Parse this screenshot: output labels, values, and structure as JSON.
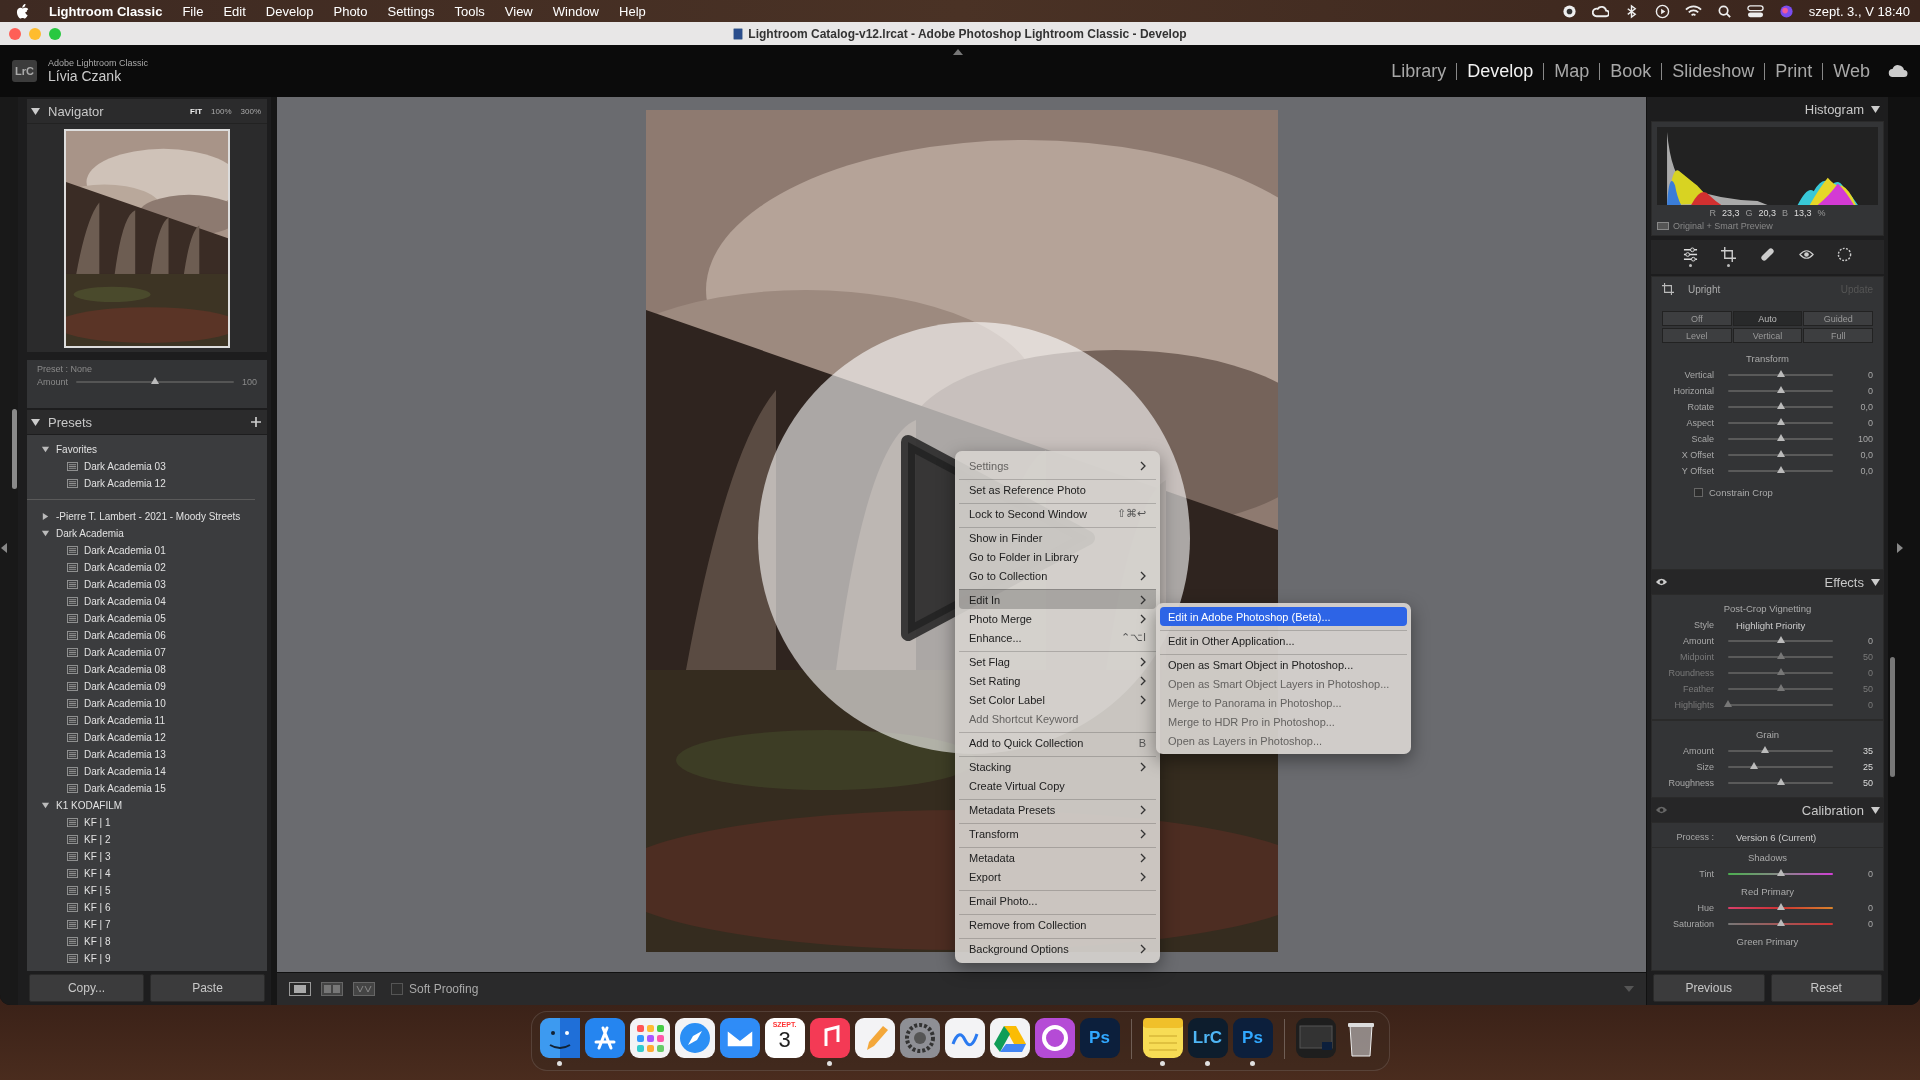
{
  "menu_bar": {
    "app": "Lightroom Classic",
    "items": [
      "File",
      "Edit",
      "Develop",
      "Photo",
      "Settings",
      "Tools",
      "View",
      "Window",
      "Help"
    ],
    "clock": "szept. 3., V 18:40"
  },
  "window": {
    "title": "Lightroom Catalog-v12.lrcat - Adobe Photoshop Lightroom Classic - Develop"
  },
  "identity": {
    "logo": "LrC",
    "product": "Adobe Lightroom Classic",
    "user": "Lívia Czank"
  },
  "modules": [
    {
      "label": "Library",
      "selected": false
    },
    {
      "label": "Develop",
      "selected": true
    },
    {
      "label": "Map",
      "selected": false
    },
    {
      "label": "Book",
      "selected": false
    },
    {
      "label": "Slideshow",
      "selected": false
    },
    {
      "label": "Print",
      "selected": false
    },
    {
      "label": "Web",
      "selected": false
    }
  ],
  "navigator": {
    "title": "Navigator",
    "zoom_options": [
      "FIT",
      "100%",
      "300%"
    ]
  },
  "preset_amount": {
    "preset": "Preset : None",
    "label": "Amount",
    "value": "100",
    "level": 0.5
  },
  "presets": {
    "title": "Presets",
    "tree": [
      {
        "label": "Favorites",
        "expanded": true,
        "separator_after": true,
        "children": [
          {
            "label": "Dark Academia 03"
          },
          {
            "label": "Dark Academia 12"
          }
        ]
      },
      {
        "label": "-Pierre T. Lambert - 2021 - Moody Streets",
        "expanded": false,
        "separator_after": false
      },
      {
        "label": "Dark Academia",
        "expanded": true,
        "separator_after": false,
        "children": [
          {
            "label": "Dark Academia 01"
          },
          {
            "label": "Dark Academia 02"
          },
          {
            "label": "Dark Academia 03"
          },
          {
            "label": "Dark Academia 04"
          },
          {
            "label": "Dark Academia 05"
          },
          {
            "label": "Dark Academia 06"
          },
          {
            "label": "Dark Academia 07"
          },
          {
            "label": "Dark Academia 08"
          },
          {
            "label": "Dark Academia 09"
          },
          {
            "label": "Dark Academia 10"
          },
          {
            "label": "Dark Academia 11"
          },
          {
            "label": "Dark Academia 12"
          },
          {
            "label": "Dark Academia 13"
          },
          {
            "label": "Dark Academia 14"
          },
          {
            "label": "Dark Academia 15"
          }
        ]
      },
      {
        "label": "K1 KODAFILM",
        "expanded": true,
        "separator_after": false,
        "children": [
          {
            "label": "KF | 1"
          },
          {
            "label": "KF | 2"
          },
          {
            "label": "KF | 3"
          },
          {
            "label": "KF | 4"
          },
          {
            "label": "KF | 5"
          },
          {
            "label": "KF | 6"
          },
          {
            "label": "KF | 7"
          },
          {
            "label": "KF | 8"
          },
          {
            "label": "KF | 9"
          }
        ]
      }
    ]
  },
  "left_buttons": [
    "Copy...",
    "Paste"
  ],
  "toolbar": {
    "soft_proofing": {
      "label": "Soft Proofing",
      "checked": false
    }
  },
  "context_menu": [
    {
      "label": "Settings",
      "submenu": true,
      "separator_before": false,
      "disabled": true,
      "selected": false
    },
    {
      "label": "Set as Reference Photo",
      "submenu": false,
      "separator_before": true,
      "disabled": false,
      "selected": false
    },
    {
      "label": "Lock to Second Window",
      "shortcut": "⇧⌘↩",
      "submenu": false,
      "separator_before": true,
      "disabled": false,
      "selected": false
    },
    {
      "label": "Show in Finder",
      "submenu": false,
      "separator_before": true,
      "disabled": false,
      "selected": false
    },
    {
      "label": "Go to Folder in Library",
      "submenu": false,
      "separator_before": false,
      "disabled": false,
      "selected": false
    },
    {
      "label": "Go to Collection",
      "submenu": true,
      "separator_before": false,
      "disabled": false,
      "selected": false
    },
    {
      "label": "Edit In",
      "submenu": true,
      "separator_before": true,
      "disabled": false,
      "selected": true
    },
    {
      "label": "Photo Merge",
      "submenu": true,
      "separator_before": false,
      "disabled": false,
      "selected": false
    },
    {
      "label": "Enhance...",
      "shortcut": "⌃⌥I",
      "submenu": false,
      "separator_before": false,
      "disabled": false,
      "selected": false
    },
    {
      "label": "Set Flag",
      "submenu": true,
      "separator_before": true,
      "disabled": false,
      "selected": false
    },
    {
      "label": "Set Rating",
      "submenu": true,
      "separator_before": false,
      "disabled": false,
      "selected": false
    },
    {
      "label": "Set Color Label",
      "submenu": true,
      "separator_before": false,
      "disabled": false,
      "selected": false
    },
    {
      "label": "Add Shortcut Keyword",
      "submenu": false,
      "separator_before": false,
      "disabled": true,
      "selected": false
    },
    {
      "label": "Add to Quick Collection",
      "shortcut": "B",
      "submenu": false,
      "separator_before": true,
      "disabled": false,
      "selected": false
    },
    {
      "label": "Stacking",
      "submenu": true,
      "separator_before": true,
      "disabled": false,
      "selected": false
    },
    {
      "label": "Create Virtual Copy",
      "submenu": false,
      "separator_before": false,
      "disabled": false,
      "selected": false
    },
    {
      "label": "Metadata Presets",
      "submenu": true,
      "separator_before": true,
      "disabled": false,
      "selected": false
    },
    {
      "label": "Transform",
      "submenu": true,
      "separator_before": true,
      "disabled": false,
      "selected": false
    },
    {
      "label": "Metadata",
      "submenu": true,
      "separator_before": true,
      "disabled": false,
      "selected": false
    },
    {
      "label": "Export",
      "submenu": true,
      "separator_before": false,
      "disabled": false,
      "selected": false
    },
    {
      "label": "Email Photo...",
      "submenu": false,
      "separator_before": true,
      "disabled": false,
      "selected": false
    },
    {
      "label": "Remove from Collection",
      "submenu": false,
      "separator_before": true,
      "disabled": false,
      "selected": false
    },
    {
      "label": "Background Options",
      "submenu": true,
      "separator_before": true,
      "disabled": false,
      "selected": false
    }
  ],
  "submenu": [
    {
      "label": "Edit in Adobe Photoshop (Beta)...",
      "separator_before": false,
      "disabled": false,
      "selected": true
    },
    {
      "label": "Edit in Other Application...",
      "separator_before": true,
      "disabled": false,
      "selected": false
    },
    {
      "label": "Open as Smart Object in Photoshop...",
      "separator_before": true,
      "disabled": false,
      "selected": false
    },
    {
      "label": "Open as Smart Object Layers in Photoshop...",
      "separator_before": false,
      "disabled": true,
      "selected": false
    },
    {
      "label": "Merge to Panorama in Photoshop...",
      "separator_before": false,
      "disabled": true,
      "selected": false
    },
    {
      "label": "Merge to HDR Pro in Photoshop...",
      "separator_before": false,
      "disabled": true,
      "selected": false
    },
    {
      "label": "Open as Layers in Photoshop...",
      "separator_before": false,
      "disabled": true,
      "selected": false
    }
  ],
  "histogram": {
    "title": "Histogram",
    "readout": [
      {
        "channel": "R",
        "value": "23,3"
      },
      {
        "channel": "G",
        "value": "20,3"
      },
      {
        "channel": "B",
        "value": "13,3"
      }
    ],
    "unit": "%",
    "preview": "Original + Smart Preview"
  },
  "tool_strip": [
    {
      "kind": "sliders",
      "dot": true
    },
    {
      "kind": "crop",
      "dot": true
    },
    {
      "kind": "heal",
      "dot": false
    },
    {
      "kind": "redeye",
      "dot": false
    },
    {
      "kind": "mask",
      "dot": false
    }
  ],
  "upright": {
    "title": "Upright",
    "action": "Update",
    "modes": [
      {
        "label": "Off",
        "selected": false
      },
      {
        "label": "Auto",
        "selected": true
      },
      {
        "label": "Guided",
        "selected": false
      },
      {
        "label": "Level",
        "selected": false
      },
      {
        "label": "Vertical",
        "selected": false
      },
      {
        "label": "Full",
        "selected": false
      }
    ]
  },
  "transform": {
    "title": "Transform",
    "sliders": [
      {
        "name": "Vertical",
        "value": "0",
        "level": 0.5
      },
      {
        "name": "Horizontal",
        "value": "0",
        "level": 0.5
      },
      {
        "name": "Rotate",
        "value": "0,0",
        "level": 0.5
      },
      {
        "name": "Aspect",
        "value": "0",
        "level": 0.5
      },
      {
        "name": "Scale",
        "value": "100",
        "level": 0.5
      },
      {
        "name": "X Offset",
        "value": "0,0",
        "level": 0.5
      },
      {
        "name": "Y Offset",
        "value": "0,0",
        "level": 0.5
      }
    ],
    "constrain_crop": {
      "label": "Constrain Crop",
      "checked": false
    }
  },
  "effects": {
    "title": "Effects",
    "vignetting": {
      "title": "Post-Crop Vignetting",
      "style_label": "Style",
      "style": "Highlight Priority",
      "sliders": [
        {
          "name": "Amount",
          "value": "0",
          "level": 0.5,
          "disabled": false
        },
        {
          "name": "Midpoint",
          "value": "50",
          "level": 0.5,
          "disabled": true
        },
        {
          "name": "Roundness",
          "value": "0",
          "level": 0.5,
          "disabled": true
        },
        {
          "name": "Feather",
          "value": "50",
          "level": 0.5,
          "disabled": true
        },
        {
          "name": "Highlights",
          "value": "0",
          "level": 0,
          "disabled": true
        }
      ]
    },
    "grain": {
      "title": "Grain",
      "sliders": [
        {
          "name": "Amount",
          "value": "35",
          "level": 0.35,
          "disabled": false
        },
        {
          "name": "Size",
          "value": "25",
          "level": 0.25,
          "disabled": false
        },
        {
          "name": "Roughness",
          "value": "50",
          "level": 0.5,
          "disabled": false
        }
      ]
    }
  },
  "calibration": {
    "title": "Calibration",
    "process_label": "Process :",
    "process": "Version 6 (Current)",
    "groups": [
      {
        "title": "Shadows",
        "sliders": [
          {
            "name": "Tint",
            "value": "0",
            "level": 0.5,
            "kind": "tint"
          }
        ]
      },
      {
        "title": "Red Primary",
        "sliders": [
          {
            "name": "Hue",
            "value": "0",
            "level": 0.5,
            "kind": "hue"
          },
          {
            "name": "Saturation",
            "value": "0",
            "level": 0.5,
            "kind": "saturation"
          }
        ]
      },
      {
        "title": "Green Primary"
      }
    ]
  },
  "right_buttons": [
    "Previous",
    "Reset"
  ],
  "dock": [
    {
      "kind": "finder",
      "running": true
    },
    {
      "kind": "appstore",
      "running": false
    },
    {
      "kind": "launchpad",
      "running": false
    },
    {
      "kind": "safari",
      "running": false
    },
    {
      "kind": "mail",
      "running": false
    },
    {
      "kind": "calendar",
      "month": "SZEPT.",
      "day": "3",
      "running": false
    },
    {
      "kind": "music",
      "running": true
    },
    {
      "kind": "pencil",
      "running": false
    },
    {
      "kind": "settings",
      "running": false
    },
    {
      "kind": "freeform",
      "running": false
    },
    {
      "kind": "drive",
      "running": false
    },
    {
      "kind": "cloud",
      "running": false
    },
    {
      "kind": "ps",
      "text": "Ps",
      "running": false
    },
    {
      "kind": "divider"
    },
    {
      "kind": "notes",
      "running": true
    },
    {
      "kind": "lrc",
      "text": "LrC",
      "running": true
    },
    {
      "kind": "ps",
      "text": "Ps",
      "running": true
    },
    {
      "kind": "divider"
    },
    {
      "kind": "window",
      "running": false
    },
    {
      "kind": "trash",
      "running": false
    }
  ]
}
